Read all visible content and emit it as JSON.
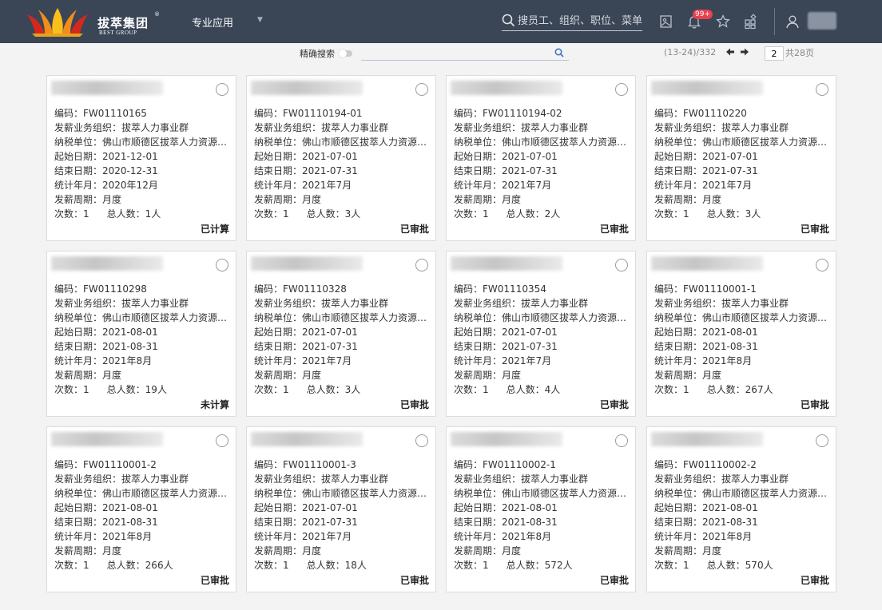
{
  "header": {
    "brand_cn": "拔萃集团",
    "brand_en": "BEST GROUP",
    "reg_mark": "®",
    "nav_label": "专业应用",
    "search_placeholder": "搜员工、组织、职位、菜单",
    "notification_badge": "99+",
    "colors": {
      "bar": "#3a4556",
      "badge": "#e8414f"
    }
  },
  "toolbar": {
    "exact_search_label": "精确搜索",
    "range_text": "(13-24)/332",
    "prev_arrow": "🡄",
    "next_arrow": "🡆",
    "current_page": "2",
    "total_pages": "共28页"
  },
  "labels": {
    "code": "编码：",
    "org": "发薪业务组织：",
    "tax": "纳税单位：",
    "start": "起始日期：",
    "end": "结束日期：",
    "period": "统计年月：",
    "cycle": "发薪周期：",
    "times": "次数：",
    "total": "总人数："
  },
  "cards": [
    {
      "code": "FW01110165",
      "org": "拔萃人力事业群",
      "tax": "佛山市顺德区拔萃人力资源有...",
      "start": "2021-12-01",
      "end": "2020-12-31",
      "period": "2020年12月",
      "cycle": "月度",
      "times": "1",
      "total": "1人",
      "status": "已计算"
    },
    {
      "code": "FW01110194-01",
      "org": "拔萃人力事业群",
      "tax": "佛山市顺德区拔萃人力资源有...",
      "start": "2021-07-01",
      "end": "2021-07-31",
      "period": "2021年7月",
      "cycle": "月度",
      "times": "1",
      "total": "3人",
      "status": "已审批"
    },
    {
      "code": "FW01110194-02",
      "org": "拔萃人力事业群",
      "tax": "佛山市顺德区拔萃人力资源有...",
      "start": "2021-07-01",
      "end": "2021-07-31",
      "period": "2021年7月",
      "cycle": "月度",
      "times": "1",
      "total": "2人",
      "status": "已审批"
    },
    {
      "code": "FW01110220",
      "org": "拔萃人力事业群",
      "tax": "佛山市顺德区拔萃人力资源有...",
      "start": "2021-07-01",
      "end": "2021-07-31",
      "period": "2021年7月",
      "cycle": "月度",
      "times": "1",
      "total": "3人",
      "status": "已审批"
    },
    {
      "code": "FW01110298",
      "org": "拔萃人力事业群",
      "tax": "佛山市顺德区拔萃人力资源有...",
      "start": "2021-08-01",
      "end": "2021-08-31",
      "period": "2021年8月",
      "cycle": "月度",
      "times": "1",
      "total": "19人",
      "status": "未计算"
    },
    {
      "code": "FW01110328",
      "org": "拔萃人力事业群",
      "tax": "佛山市顺德区拔萃人力资源有...",
      "start": "2021-07-01",
      "end": "2021-07-31",
      "period": "2021年7月",
      "cycle": "月度",
      "times": "1",
      "total": "3人",
      "status": "已审批"
    },
    {
      "code": "FW01110354",
      "org": "拔萃人力事业群",
      "tax": "佛山市顺德区拔萃人力资源有...",
      "start": "2021-07-01",
      "end": "2021-07-31",
      "period": "2021年7月",
      "cycle": "月度",
      "times": "1",
      "total": "4人",
      "status": "已审批"
    },
    {
      "code": "FW01110001-1",
      "org": "拔萃人力事业群",
      "tax": "佛山市顺德区拔萃人力资源有...",
      "start": "2021-08-01",
      "end": "2021-08-31",
      "period": "2021年8月",
      "cycle": "月度",
      "times": "1",
      "total": "267人",
      "status": "已审批"
    },
    {
      "code": "FW01110001-2",
      "org": "拔萃人力事业群",
      "tax": "佛山市顺德区拔萃人力资源有...",
      "start": "2021-08-01",
      "end": "2021-08-31",
      "period": "2021年8月",
      "cycle": "月度",
      "times": "1",
      "total": "266人",
      "status": "已审批"
    },
    {
      "code": "FW01110001-3",
      "org": "拔萃人力事业群",
      "tax": "佛山市顺德区拔萃人力资源有...",
      "start": "2021-07-01",
      "end": "2021-07-31",
      "period": "2021年7月",
      "cycle": "月度",
      "times": "1",
      "total": "18人",
      "status": "已审批"
    },
    {
      "code": "FW01110002-1",
      "org": "拔萃人力事业群",
      "tax": "佛山市顺德区拔萃人力资源有...",
      "start": "2021-08-01",
      "end": "2021-08-31",
      "period": "2021年8月",
      "cycle": "月度",
      "times": "1",
      "total": "572人",
      "status": "已审批"
    },
    {
      "code": "FW01110002-2",
      "org": "拔萃人力事业群",
      "tax": "佛山市顺德区拔萃人力资源有...",
      "start": "2021-08-01",
      "end": "2021-08-31",
      "period": "2021年8月",
      "cycle": "月度",
      "times": "1",
      "total": "570人",
      "status": "已审批"
    }
  ]
}
